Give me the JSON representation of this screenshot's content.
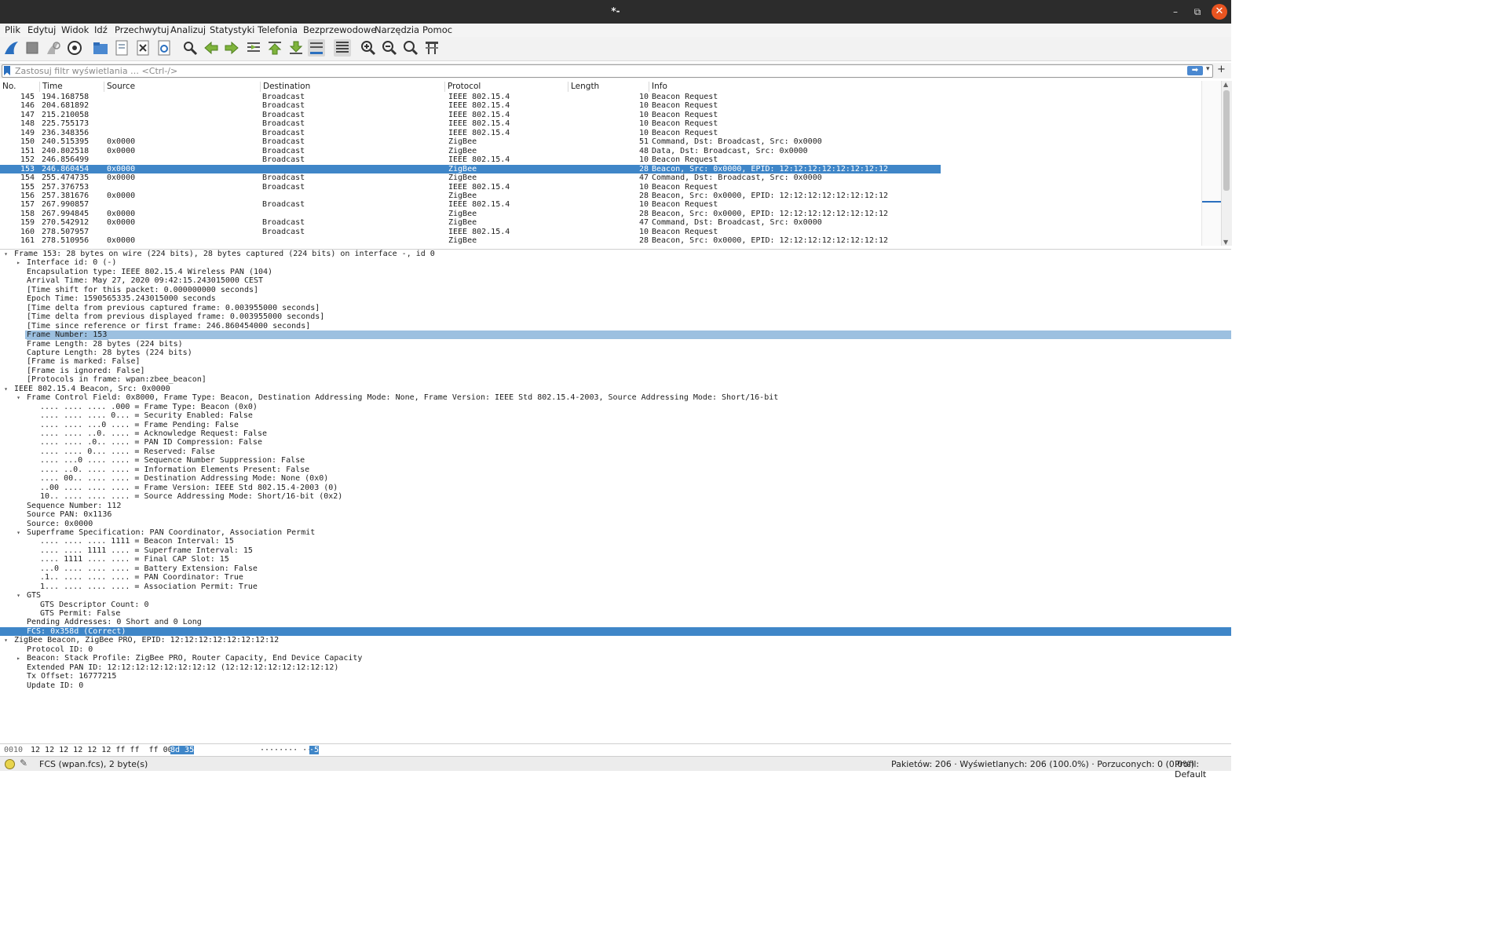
{
  "window": {
    "title": "*-"
  },
  "menu": [
    "Plik",
    "Edytuj",
    "Widok",
    "Idź",
    "Przechwytuj",
    "Analizuj",
    "Statystyki",
    "Telefonia",
    "Bezprzewodowe",
    "Narzędzia",
    "Pomoc"
  ],
  "toolbar_icons": [
    "shark-fin-icon",
    "stop-icon",
    "restart-capture-icon",
    "capture-options-icon",
    "open-file-icon",
    "save-file-icon",
    "close-file-icon",
    "reload-icon",
    "find-packet-icon",
    "go-back-icon",
    "go-forward-icon",
    "go-to-packet-icon",
    "first-packet-icon",
    "last-packet-icon",
    "autoscroll-icon",
    "colorize-icon",
    "zoom-in-icon",
    "zoom-out-icon",
    "zoom-normal-icon",
    "resize-columns-icon"
  ],
  "filter": {
    "placeholder": "Zastosuj filtr wyświetlania … <Ctrl-/>"
  },
  "packet_list": {
    "columns": [
      "No.",
      "Time",
      "Source",
      "Destination",
      "Protocol",
      "Length",
      "Info"
    ],
    "rows": [
      {
        "no": "145",
        "time": "194.168758",
        "src": "",
        "dst": "Broadcast",
        "proto": "IEEE 802.15.4",
        "len": "10",
        "info": "Beacon Request"
      },
      {
        "no": "146",
        "time": "204.681892",
        "src": "",
        "dst": "Broadcast",
        "proto": "IEEE 802.15.4",
        "len": "10",
        "info": "Beacon Request"
      },
      {
        "no": "147",
        "time": "215.210058",
        "src": "",
        "dst": "Broadcast",
        "proto": "IEEE 802.15.4",
        "len": "10",
        "info": "Beacon Request"
      },
      {
        "no": "148",
        "time": "225.755173",
        "src": "",
        "dst": "Broadcast",
        "proto": "IEEE 802.15.4",
        "len": "10",
        "info": "Beacon Request"
      },
      {
        "no": "149",
        "time": "236.348356",
        "src": "",
        "dst": "Broadcast",
        "proto": "IEEE 802.15.4",
        "len": "10",
        "info": "Beacon Request"
      },
      {
        "no": "150",
        "time": "240.515395",
        "src": "0x0000",
        "dst": "Broadcast",
        "proto": "ZigBee",
        "len": "51",
        "info": "Command, Dst: Broadcast, Src: 0x0000"
      },
      {
        "no": "151",
        "time": "240.802518",
        "src": "0x0000",
        "dst": "Broadcast",
        "proto": "ZigBee",
        "len": "48",
        "info": "Data, Dst: Broadcast, Src: 0x0000"
      },
      {
        "no": "152",
        "time": "246.856499",
        "src": "",
        "dst": "Broadcast",
        "proto": "IEEE 802.15.4",
        "len": "10",
        "info": "Beacon Request"
      },
      {
        "no": "153",
        "time": "246.860454",
        "src": "0x0000",
        "dst": "",
        "proto": "ZigBee",
        "len": "28",
        "info": "Beacon, Src: 0x0000, EPID: 12:12:12:12:12:12:12:12",
        "selected": true
      },
      {
        "no": "154",
        "time": "255.474735",
        "src": "0x0000",
        "dst": "Broadcast",
        "proto": "ZigBee",
        "len": "47",
        "info": "Command, Dst: Broadcast, Src: 0x0000"
      },
      {
        "no": "155",
        "time": "257.376753",
        "src": "",
        "dst": "Broadcast",
        "proto": "IEEE 802.15.4",
        "len": "10",
        "info": "Beacon Request"
      },
      {
        "no": "156",
        "time": "257.381676",
        "src": "0x0000",
        "dst": "",
        "proto": "ZigBee",
        "len": "28",
        "info": "Beacon, Src: 0x0000, EPID: 12:12:12:12:12:12:12:12"
      },
      {
        "no": "157",
        "time": "267.990857",
        "src": "",
        "dst": "Broadcast",
        "proto": "IEEE 802.15.4",
        "len": "10",
        "info": "Beacon Request"
      },
      {
        "no": "158",
        "time": "267.994845",
        "src": "0x0000",
        "dst": "",
        "proto": "ZigBee",
        "len": "28",
        "info": "Beacon, Src: 0x0000, EPID: 12:12:12:12:12:12:12:12"
      },
      {
        "no": "159",
        "time": "270.542912",
        "src": "0x0000",
        "dst": "Broadcast",
        "proto": "ZigBee",
        "len": "47",
        "info": "Command, Dst: Broadcast, Src: 0x0000"
      },
      {
        "no": "160",
        "time": "278.507957",
        "src": "",
        "dst": "Broadcast",
        "proto": "IEEE 802.15.4",
        "len": "10",
        "info": "Beacon Request"
      },
      {
        "no": "161",
        "time": "278.510956",
        "src": "0x0000",
        "dst": "",
        "proto": "ZigBee",
        "len": "28",
        "info": "Beacon, Src: 0x0000, EPID: 12:12:12:12:12:12:12:12"
      }
    ]
  },
  "details": [
    {
      "level": 0,
      "toggle": "open",
      "text": "Frame 153: 28 bytes on wire (224 bits), 28 bytes captured (224 bits) on interface -, id 0"
    },
    {
      "level": 1,
      "toggle": "closed",
      "text": "Interface id: 0 (-)"
    },
    {
      "level": 1,
      "text": "Encapsulation type: IEEE 802.15.4 Wireless PAN (104)"
    },
    {
      "level": 1,
      "text": "Arrival Time: May 27, 2020 09:42:15.243015000 CEST"
    },
    {
      "level": 1,
      "text": "[Time shift for this packet: 0.000000000 seconds]"
    },
    {
      "level": 1,
      "text": "Epoch Time: 1590565335.243015000 seconds"
    },
    {
      "level": 1,
      "text": "[Time delta from previous captured frame: 0.003955000 seconds]"
    },
    {
      "level": 1,
      "text": "[Time delta from previous displayed frame: 0.003955000 seconds]"
    },
    {
      "level": 1,
      "text": "[Time since reference or first frame: 246.860454000 seconds]"
    },
    {
      "level": 1,
      "text": "Frame Number: 153",
      "hl": true
    },
    {
      "level": 1,
      "text": "Frame Length: 28 bytes (224 bits)"
    },
    {
      "level": 1,
      "text": "Capture Length: 28 bytes (224 bits)"
    },
    {
      "level": 1,
      "text": "[Frame is marked: False]"
    },
    {
      "level": 1,
      "text": "[Frame is ignored: False]"
    },
    {
      "level": 1,
      "text": "[Protocols in frame: wpan:zbee_beacon]"
    },
    {
      "level": 0,
      "toggle": "open",
      "text": "IEEE 802.15.4 Beacon, Src: 0x0000"
    },
    {
      "level": 1,
      "toggle": "open",
      "text": "Frame Control Field: 0x8000, Frame Type: Beacon, Destination Addressing Mode: None, Frame Version: IEEE Std 802.15.4-2003, Source Addressing Mode: Short/16-bit"
    },
    {
      "level": 2,
      "text": ".... .... .... .000 = Frame Type: Beacon (0x0)"
    },
    {
      "level": 2,
      "text": ".... .... .... 0... = Security Enabled: False"
    },
    {
      "level": 2,
      "text": ".... .... ...0 .... = Frame Pending: False"
    },
    {
      "level": 2,
      "text": ".... .... ..0. .... = Acknowledge Request: False"
    },
    {
      "level": 2,
      "text": ".... .... .0.. .... = PAN ID Compression: False"
    },
    {
      "level": 2,
      "text": ".... .... 0... .... = Reserved: False"
    },
    {
      "level": 2,
      "text": ".... ...0 .... .... = Sequence Number Suppression: False"
    },
    {
      "level": 2,
      "text": ".... ..0. .... .... = Information Elements Present: False"
    },
    {
      "level": 2,
      "text": ".... 00.. .... .... = Destination Addressing Mode: None (0x0)"
    },
    {
      "level": 2,
      "text": "..00 .... .... .... = Frame Version: IEEE Std 802.15.4-2003 (0)"
    },
    {
      "level": 2,
      "text": "10.. .... .... .... = Source Addressing Mode: Short/16-bit (0x2)"
    },
    {
      "level": 1,
      "text": "Sequence Number: 112"
    },
    {
      "level": 1,
      "text": "Source PAN: 0x1136"
    },
    {
      "level": 1,
      "text": "Source: 0x0000"
    },
    {
      "level": 1,
      "toggle": "open",
      "text": "Superframe Specification: PAN Coordinator, Association Permit"
    },
    {
      "level": 2,
      "text": ".... .... .... 1111 = Beacon Interval: 15"
    },
    {
      "level": 2,
      "text": ".... .... 1111 .... = Superframe Interval: 15"
    },
    {
      "level": 2,
      "text": ".... 1111 .... .... = Final CAP Slot: 15"
    },
    {
      "level": 2,
      "text": "...0 .... .... .... = Battery Extension: False"
    },
    {
      "level": 2,
      "text": ".1.. .... .... .... = PAN Coordinator: True"
    },
    {
      "level": 2,
      "text": "1... .... .... .... = Association Permit: True"
    },
    {
      "level": 1,
      "toggle": "open",
      "text": "GTS"
    },
    {
      "level": 2,
      "text": "GTS Descriptor Count: 0"
    },
    {
      "level": 2,
      "text": "GTS Permit: False"
    },
    {
      "level": 1,
      "text": "Pending Addresses: 0 Short and 0 Long"
    },
    {
      "level": 1,
      "text": "FCS: 0x358d (Correct)",
      "selected": true
    },
    {
      "level": 0,
      "toggle": "open",
      "text": "ZigBee Beacon, ZigBee PRO, EPID: 12:12:12:12:12:12:12:12"
    },
    {
      "level": 1,
      "text": "Protocol ID: 0"
    },
    {
      "level": 1,
      "toggle": "closed",
      "text": "Beacon: Stack Profile: ZigBee PRO, Router Capacity, End Device Capacity"
    },
    {
      "level": 1,
      "text": "Extended PAN ID: 12:12:12:12:12:12:12:12 (12:12:12:12:12:12:12:12)"
    },
    {
      "level": 1,
      "text": "Tx Offset: 16777215"
    },
    {
      "level": 1,
      "text": "Update ID: 0"
    }
  ],
  "bytes": {
    "offset": "0010",
    "hex": "12 12 12 12 12 12 ff ff  ff 00",
    "hex_sel": "8d 35",
    "ascii": "········ ··",
    "ascii_sel": "·5"
  },
  "status": {
    "field": "FCS (wpan.fcs), 2 byte(s)",
    "packets": "Pakietów: 206 · Wyświetlanych: 206 (100.0%) · Porzuconych: 0 (0.0%)",
    "profile": "Profil: Default"
  },
  "colors": {
    "selection": "#3f86c8",
    "highlight": "#9cc0e0",
    "titlebar": "#2c2c2c",
    "close": "#e95420"
  }
}
